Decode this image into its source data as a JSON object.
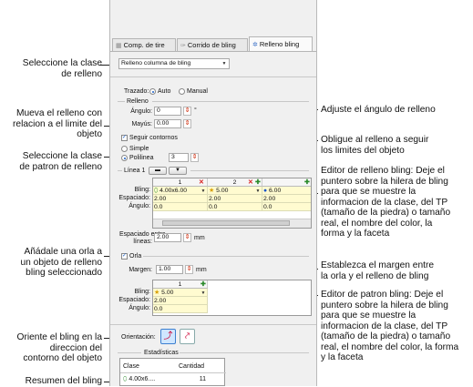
{
  "panel": {
    "tabs": [
      {
        "icon": "▦",
        "label": "Comp. de tire"
      },
      {
        "icon": "✑",
        "label": "Corrido de bling"
      },
      {
        "icon": "✲",
        "label": "Relleno bling"
      }
    ],
    "class_select": "Relleno columna de bling",
    "trazado": {
      "label": "Trazado:",
      "auto": "Auto",
      "manual": "Manual"
    },
    "relleno": {
      "group": "Relleno",
      "angle_label": "Ángulo:",
      "angle_value": "0",
      "angle_unit": "°",
      "mayus_label": "Mayús:",
      "mayus_value": "0.00"
    },
    "seguir_contornos": "Seguir contornos",
    "simple": "Simple",
    "polilinea": "Polilinea",
    "polilinea_value": "3",
    "linea": "Línea 1",
    "grid1": {
      "cols": [
        "1",
        "2"
      ],
      "row_labels": [
        "Bling:",
        "Espaciado:",
        "Ángulo:"
      ],
      "bling": [
        "4.00x6.00",
        "5.00",
        "6.00"
      ],
      "espaciado": [
        "2.00",
        "2.00",
        "2.00"
      ],
      "angulo": [
        "0.0",
        "0.0",
        "0.0"
      ]
    },
    "espaciado_lineas": {
      "label1": "Espaciado entre",
      "label2": "líneas:",
      "value": "2.00",
      "unit": "mm"
    },
    "orla": "Orla",
    "margen": {
      "label": "Margen:",
      "value": "1.00",
      "unit": "mm"
    },
    "grid2": {
      "col": "1",
      "row_labels": [
        "Bling:",
        "Espaciado:",
        "Ángulo:"
      ],
      "bling": "5.00",
      "espaciado": "2.00",
      "angulo": "0.0"
    },
    "orientacion": "Orientación:",
    "estadisticas": {
      "title": "Estadísticas",
      "col1": "Clase",
      "col2": "Cantidad",
      "row_clase": "4.00x6....",
      "row_cantidad": "11"
    }
  },
  "annotations_left": [
    "Seleccione la clase\nde relleno",
    "Mueva el relleno con\nrelacion a el limite del\nobjeto",
    "Seleccione la clase\nde patron de relleno",
    "Añádale una orla a\nun objeto de relleno\nbling seleccionado",
    "Oriente el bling en la\ndireccion del\ncontorno del objeto",
    "Resumen del bling"
  ],
  "annotations_right": [
    "Adjuste el ángulo de relleno",
    "Obligue al relleno a seguir\nlos limites del objeto",
    "Editor de relleno bling: Deje el\npuntero sobre la hilera de bling\npara que se muestre la\ninformacion de la clase, del TP\n(tamaño de la piedra) o tamaño\nreal, el nombre del color, la\nforma y la faceta",
    "Establezca el margen entre\nla orla y el relleno de bling",
    "Editor de patron bling: Deje el\npuntero sobre la hilera de bling\npara que se muestre la\ninformacion de la clase, del TP\n(tamaño de la piedra) o tamaño\nreal, el nombre del color, la forma\ny la faceta"
  ]
}
